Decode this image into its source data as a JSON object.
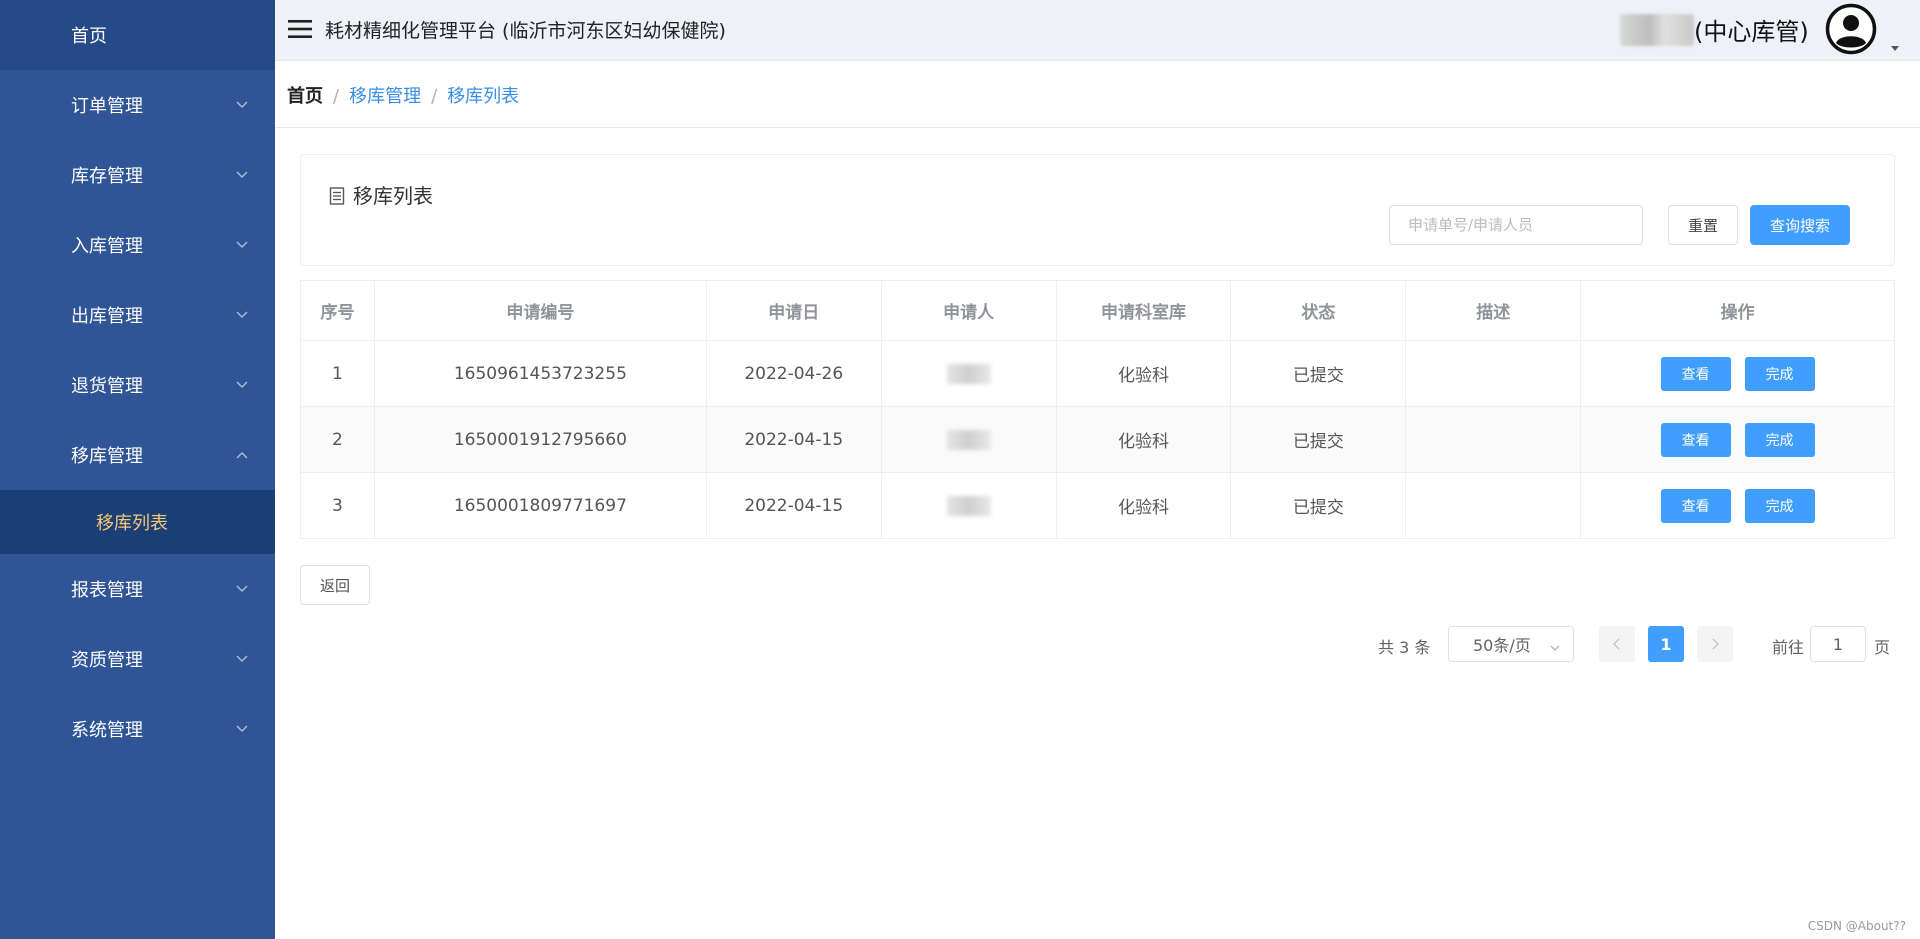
{
  "sidebar": {
    "items": [
      {
        "label": "首页"
      },
      {
        "label": "订单管理"
      },
      {
        "label": "库存管理"
      },
      {
        "label": "入库管理"
      },
      {
        "label": "出库管理"
      },
      {
        "label": "退货管理"
      },
      {
        "label": "移库管理"
      },
      {
        "label": "报表管理"
      },
      {
        "label": "资质管理"
      },
      {
        "label": "系统管理"
      }
    ],
    "active_sub": {
      "label": "移库列表"
    }
  },
  "header": {
    "title": "耗材精细化管理平台 (临沂市河东区妇幼保健院)",
    "user_role": "(中心库管)"
  },
  "breadcrumb": {
    "home": "首页",
    "level1": "移库管理",
    "level2": "移库列表",
    "separator": "/"
  },
  "search_card": {
    "title": "移库列表",
    "input_placeholder": "申请单号/申请人员",
    "reset_label": "重置",
    "search_label": "查询搜索"
  },
  "table": {
    "headers": [
      "序号",
      "申请编号",
      "申请日",
      "申请人",
      "申请科室库",
      "状态",
      "描述",
      "操作"
    ],
    "rows": [
      {
        "index": "1",
        "number": "1650961453723255",
        "date": "2022-04-26",
        "dept": "化验科",
        "status": "已提交",
        "desc": "",
        "view": "查看",
        "done": "完成"
      },
      {
        "index": "2",
        "number": "1650001912795660",
        "date": "2022-04-15",
        "dept": "化验科",
        "status": "已提交",
        "desc": "",
        "view": "查看",
        "done": "完成"
      },
      {
        "index": "3",
        "number": "1650001809771697",
        "date": "2022-04-15",
        "dept": "化验科",
        "status": "已提交",
        "desc": "",
        "view": "查看",
        "done": "完成"
      }
    ]
  },
  "back_label": "返回",
  "pagination": {
    "total_text": "共 3 条",
    "page_size": "50条/页",
    "current_page": "1",
    "goto_label": "前往",
    "goto_value": "1",
    "goto_unit": "页"
  },
  "watermark": "CSDN @About??",
  "colors": {
    "sidebar_bg": "#2f5597",
    "sidebar_active_sub_bg": "#1b3e75",
    "active_sub_text": "#f4c77b",
    "primary": "#409eff",
    "link": "#3a8ee6"
  },
  "icons": {
    "menu": "hamburger-icon",
    "avatar": "user-circle-icon",
    "card_title": "document-icon",
    "expand": "chevron-down-icon",
    "collapse": "chevron-up-icon"
  }
}
